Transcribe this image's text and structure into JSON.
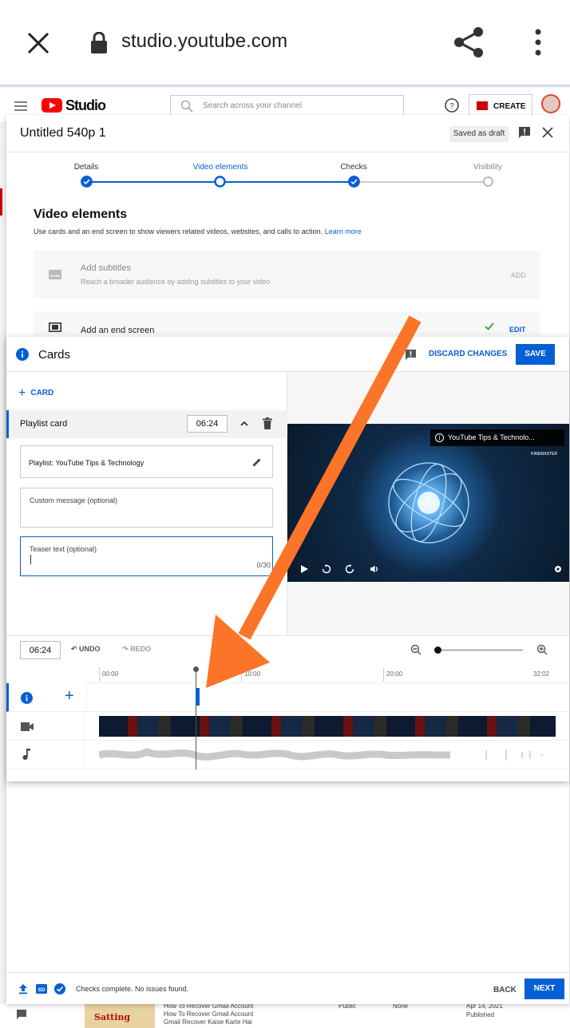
{
  "browser": {
    "url": "studio.youtube.com"
  },
  "header": {
    "logo_text": "Studio",
    "search_placeholder": "Search across your channel",
    "create_label": "CREATE"
  },
  "dialog": {
    "title": "Untitled 540p 1",
    "saved_label": "Saved as draft",
    "steps": [
      {
        "label": "Details",
        "state": "done"
      },
      {
        "label": "Video elements",
        "state": "current"
      },
      {
        "label": "Checks",
        "state": "done"
      },
      {
        "label": "Visibility",
        "state": "todo"
      }
    ],
    "section_title": "Video elements",
    "section_desc": "Use cards and an end screen to show viewers related videos, websites, and calls to action.",
    "learn_more": "Learn more",
    "subtitles": {
      "title": "Add subtitles",
      "desc": "Reach a broader audience by adding subtitles to your video",
      "action": "ADD"
    },
    "end_screen": {
      "title": "Add an end screen",
      "action": "EDIT"
    },
    "footer": {
      "status": "Checks complete. No issues found.",
      "back": "BACK",
      "next": "NEXT",
      "badge": "SD"
    }
  },
  "cards": {
    "title": "Cards",
    "discard": "DISCARD CHANGES",
    "save": "SAVE",
    "add_card": "CARD",
    "card_item": {
      "label": "Playlist card",
      "time": "06:24"
    },
    "playlist_field": "Playlist: YouTube Tips & Technology",
    "custom_message_label": "Custom message (optional)",
    "teaser_label": "Teaser text (optional)",
    "teaser_counter": "0/30",
    "preview": {
      "chip_text": "YouTube Tips & Technolo...",
      "watermark": "KINEMASTER"
    },
    "timeline": {
      "time": "06:24",
      "undo": "UNDO",
      "redo": "REDO",
      "ticks": [
        "00:00",
        "10:00",
        "20:00",
        "32:02"
      ]
    }
  },
  "behind": {
    "thumb_text": "Satting",
    "lines": [
      "How To Recover Gmail Account",
      "How To Recover Gmail Account",
      "Gmail Recover Kaise Karte Hai"
    ],
    "visibility": "Public",
    "restrictions": "None",
    "date": "Apr 14, 2021",
    "status": "Published"
  },
  "colors": {
    "accent": "#065fd4",
    "arrow": "#fb7428",
    "brand": "#ff0000"
  }
}
